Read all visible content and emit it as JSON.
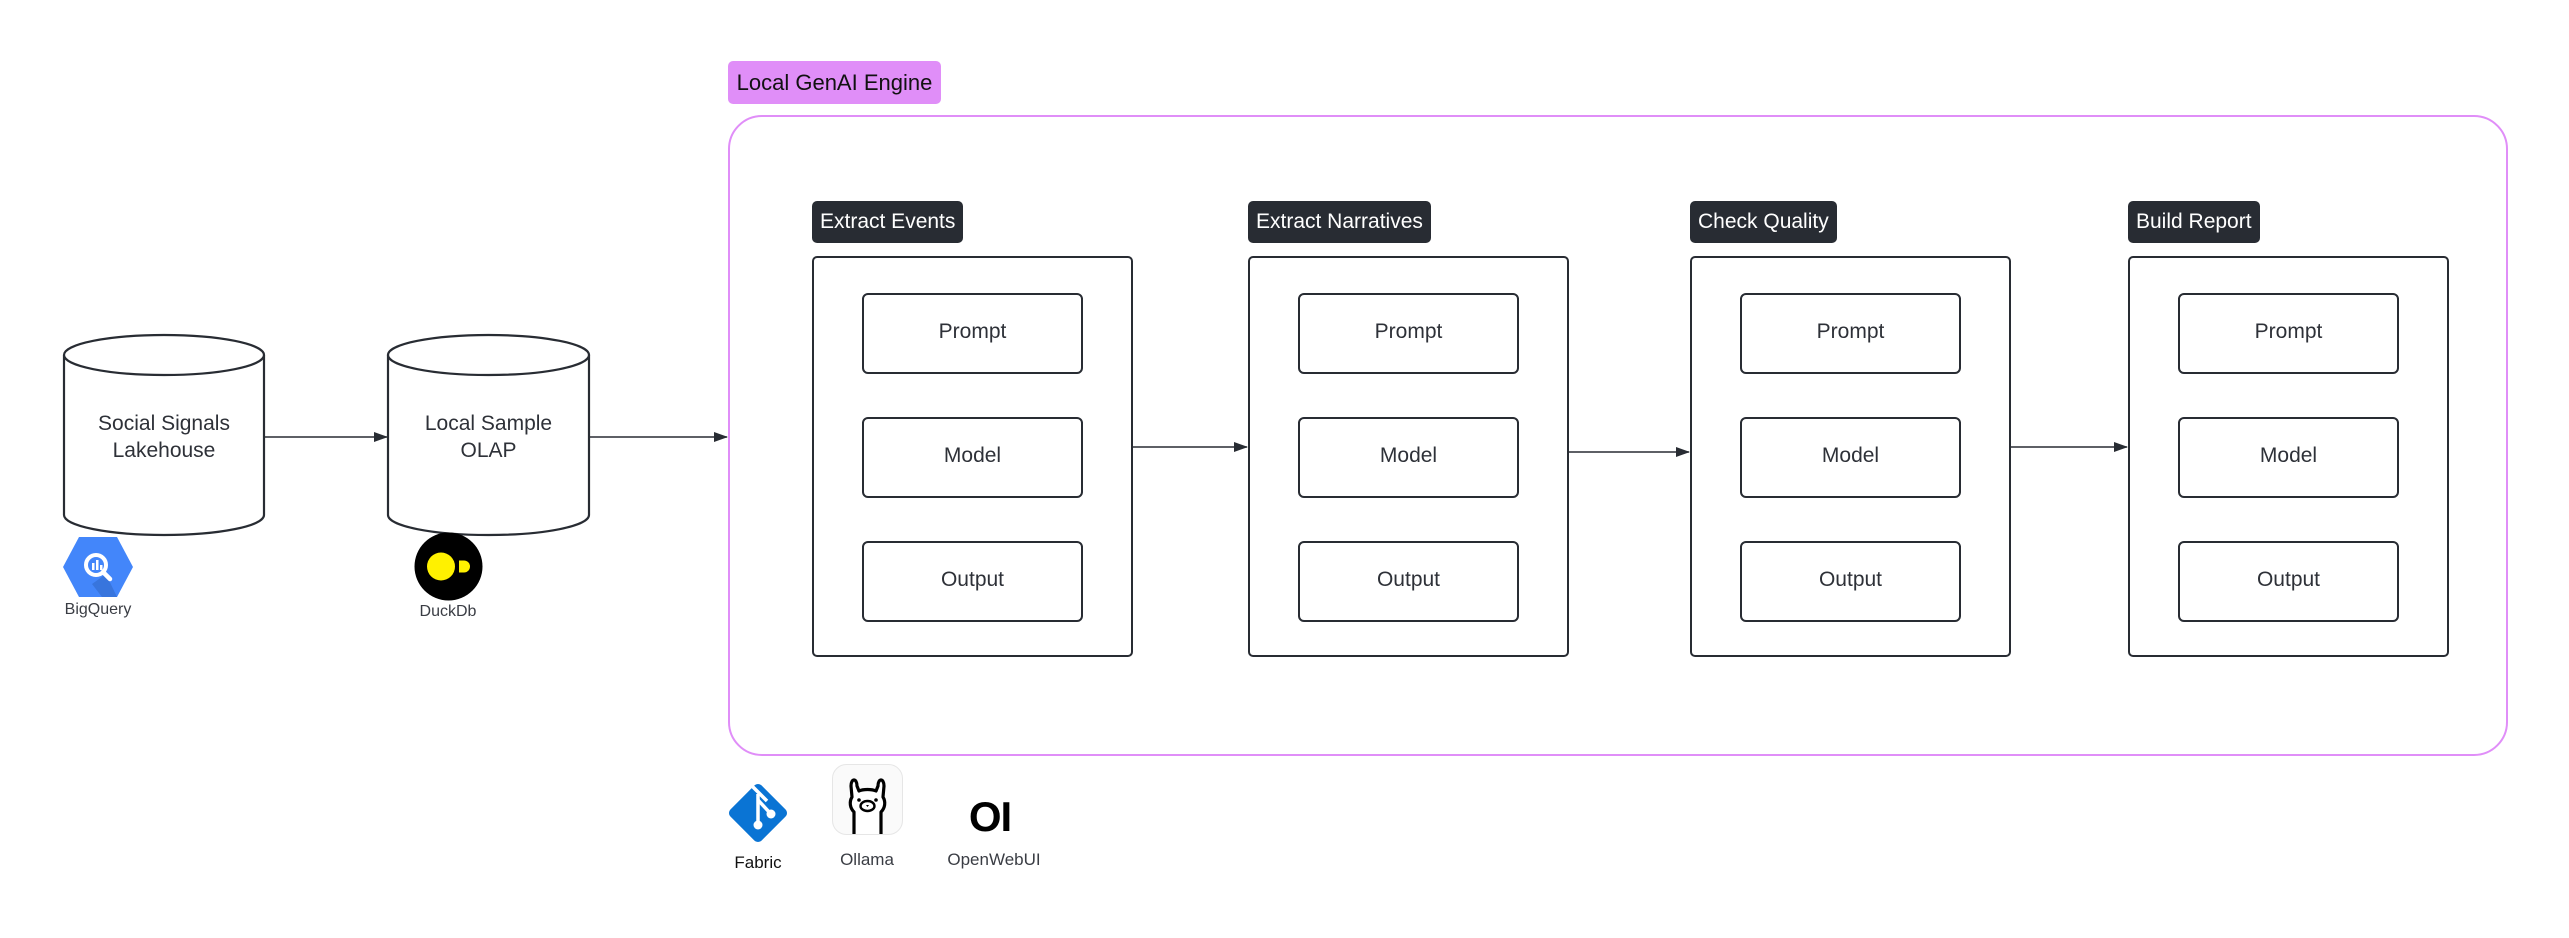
{
  "sources": [
    {
      "id": "lakehouse",
      "line1": "Social Signals",
      "line2": "Lakehouse",
      "tool": "BigQuery",
      "tool_icon": "bigquery-icon",
      "tool_color": "#4285f4"
    },
    {
      "id": "olap",
      "line1": "Local Sample",
      "line2": "OLAP",
      "tool": "DuckDb",
      "tool_icon": "duckdb-icon",
      "tool_color": "#fff000"
    }
  ],
  "engine": {
    "label": "Local GenAI Engine",
    "accent": "#e08ef8",
    "stages": [
      {
        "title": "Extract Events",
        "steps": [
          "Prompt",
          "Model",
          "Output"
        ]
      },
      {
        "title": "Extract Narratives",
        "steps": [
          "Prompt",
          "Model",
          "Output"
        ]
      },
      {
        "title": "Check Quality",
        "steps": [
          "Prompt",
          "Model",
          "Output"
        ]
      },
      {
        "title": "Build Report",
        "steps": [
          "Prompt",
          "Model",
          "Output"
        ]
      }
    ]
  },
  "tools": [
    {
      "name": "Fabric",
      "icon": "fabric-git-icon",
      "color": "#0a74d4"
    },
    {
      "name": "Ollama",
      "icon": "ollama-llama-icon"
    },
    {
      "name": "OpenWebUI",
      "icon": "openwebui-icon",
      "glyph": "OI"
    }
  ]
}
